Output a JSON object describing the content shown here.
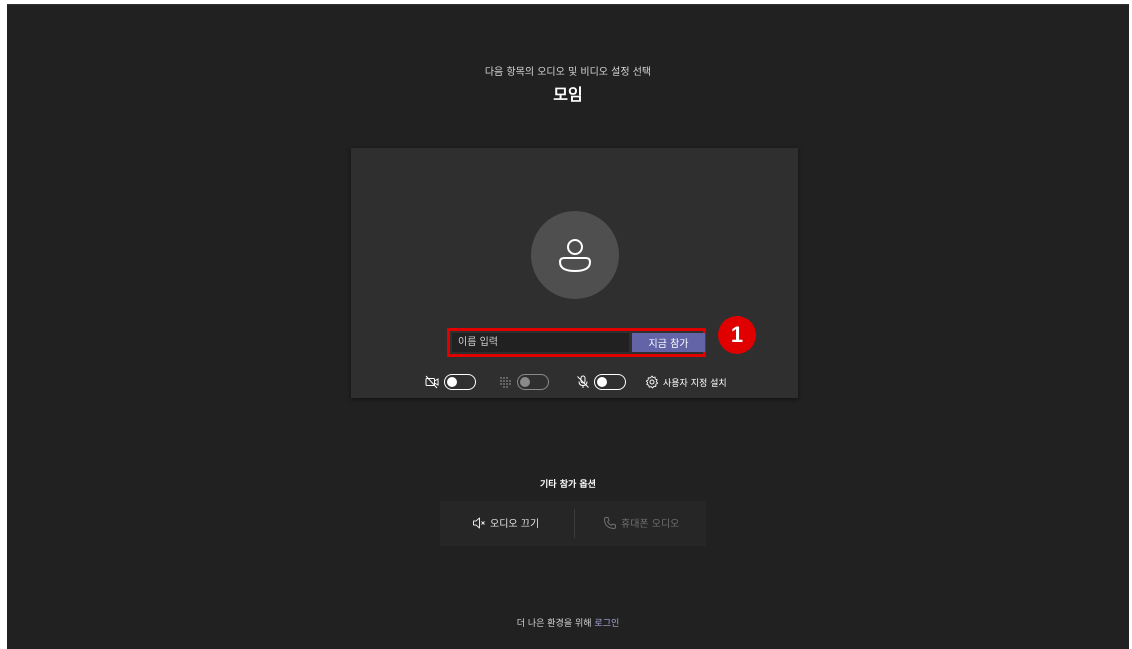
{
  "header": {
    "subtitle": "다음 항목의 오디오 및 비디오 설정 선택",
    "title": "모임"
  },
  "prejoin": {
    "avatar_icon": "person-icon",
    "name_input": {
      "placeholder": "이름 입력",
      "value": ""
    },
    "join_button": "지금 참가",
    "annotation_badge": "1",
    "controls": {
      "camera_icon": "camera-off-icon",
      "camera_on": false,
      "blur_icon": "background-blur-icon",
      "blur_on": false,
      "blur_enabled": false,
      "mic_icon": "mic-off-icon",
      "mic_on": false,
      "settings_icon": "gear-icon",
      "settings_label": "사용자 지정 설치"
    }
  },
  "other_options": {
    "title": "기타 참가 옵션",
    "audio_off": {
      "icon": "speaker-mute-icon",
      "label": "오디오 끄기"
    },
    "phone_audio": {
      "icon": "phone-icon",
      "label": "휴대폰 오디오",
      "enabled": false
    }
  },
  "footer": {
    "text": "더 나은 환경을 위해",
    "link": "로그인"
  },
  "colors": {
    "background": "#212121",
    "card": "#2f2f2f",
    "accent": "#6264a7",
    "highlight": "#e00000"
  }
}
